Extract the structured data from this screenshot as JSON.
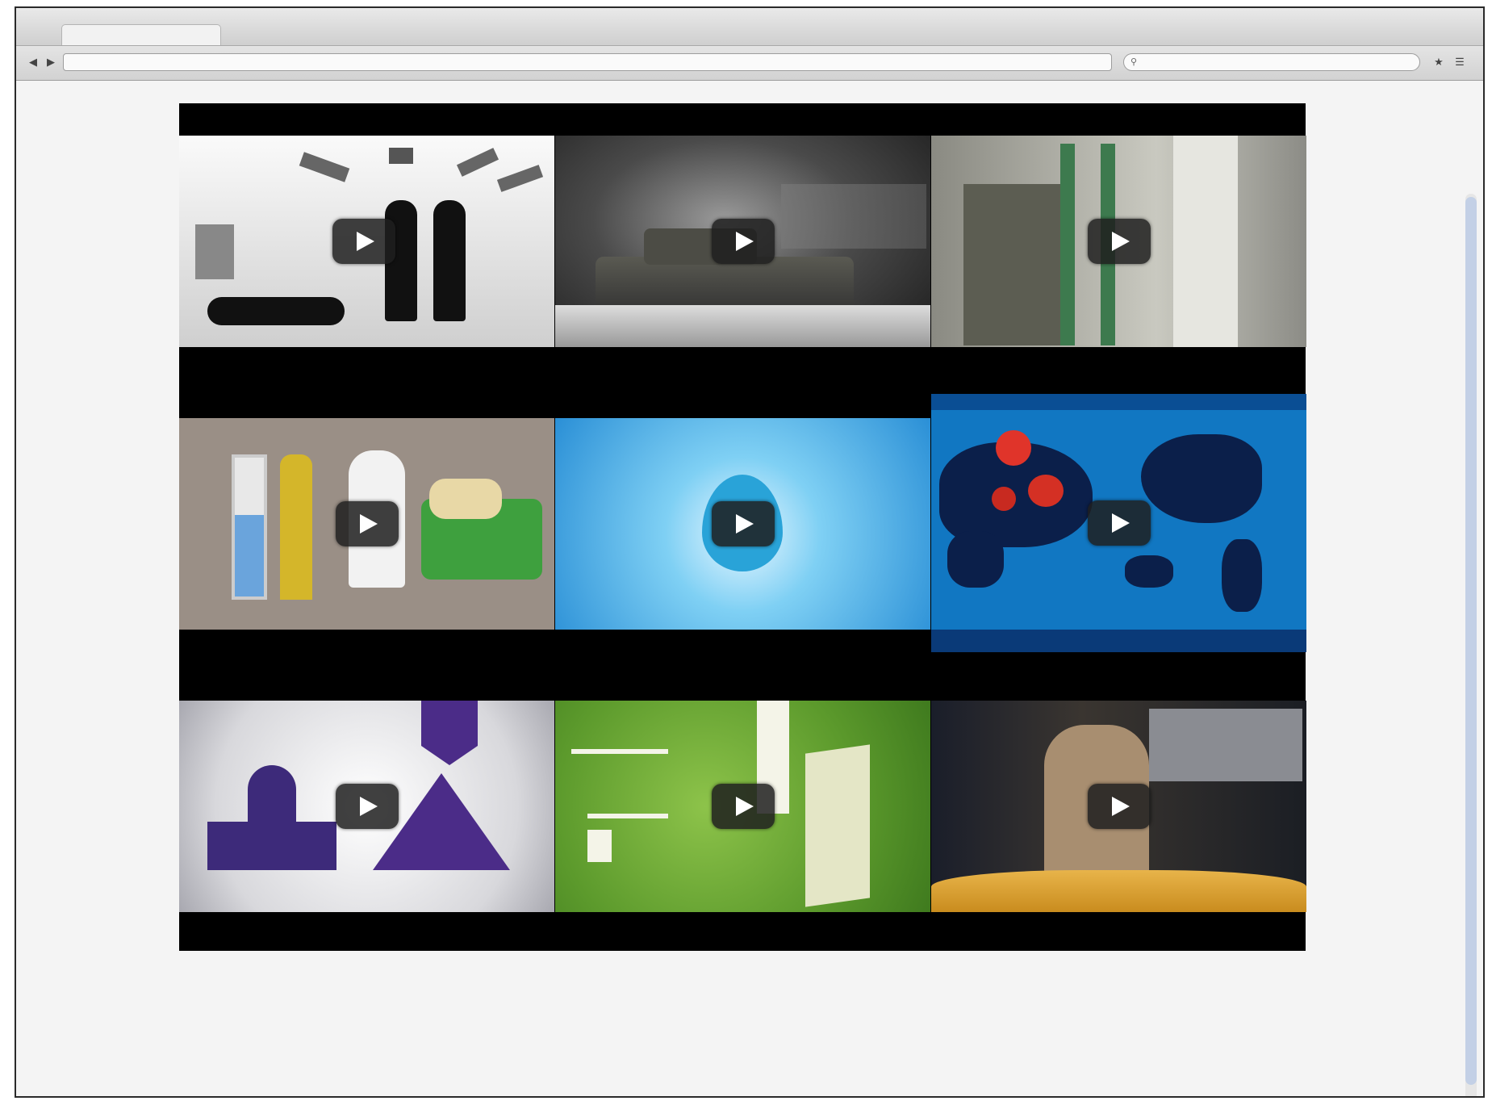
{
  "window": {
    "title": ""
  },
  "tab": {
    "label": ""
  },
  "toolbar": {
    "url": "",
    "search_placeholder": ""
  },
  "videos": [
    {
      "theme": "surveillance-cameras-figures"
    },
    {
      "theme": "tank-model"
    },
    {
      "theme": "industrial-scene"
    },
    {
      "theme": "infographic-family"
    },
    {
      "theme": "water-drop"
    },
    {
      "theme": "world-map"
    },
    {
      "theme": "government-building"
    },
    {
      "theme": "green-infographic"
    },
    {
      "theme": "news-anchor"
    }
  ],
  "caption": {
    "title": "",
    "source": "",
    "date": ""
  },
  "status": {
    "text": ""
  },
  "colors": {
    "panel_bg": "#000000",
    "page_bg": "#f4f4f4",
    "play_button": "#1e1e1e"
  },
  "icons": {
    "back": "chevron-left-icon",
    "play": "play-icon",
    "search": "search-icon"
  }
}
